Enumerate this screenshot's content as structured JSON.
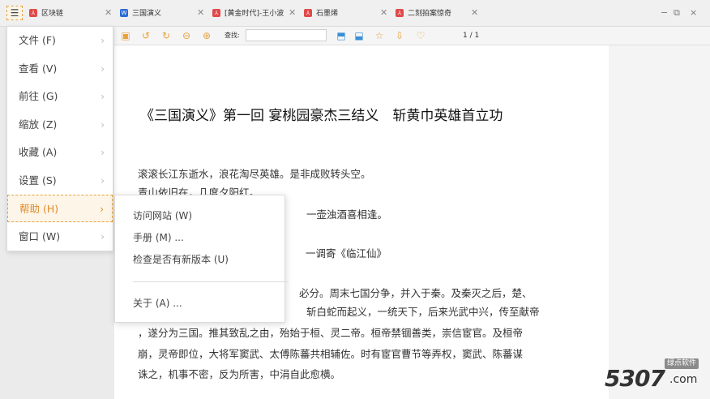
{
  "tabs": [
    {
      "label": "区块链",
      "icon": "pdf-icon",
      "color": "#e04a4a"
    },
    {
      "label": "三国演义",
      "icon": "word-icon",
      "color": "#2b6bd6"
    },
    {
      "label": "[黄金时代]-王小波",
      "icon": "pdf-icon",
      "color": "#e04a4a"
    },
    {
      "label": "石墨烯",
      "icon": "pdf-icon",
      "color": "#e04a4a"
    },
    {
      "label": "二刻拍案惊奇",
      "icon": "pdf-icon",
      "color": "#e04a4a"
    }
  ],
  "window_controls": {
    "minimize": "−",
    "restore": "⧉",
    "close": "×"
  },
  "toolbar": {
    "search_label": "查找:",
    "search_value": "",
    "page_count": "1 / 1",
    "icons": [
      "open-icon",
      "undo-icon",
      "redo-icon",
      "zoom-out-icon",
      "zoom-in-icon",
      "prev-page-icon",
      "next-page-icon",
      "favorite-star-icon",
      "download-icon",
      "vip-heart-icon"
    ]
  },
  "main_menu": {
    "items": [
      {
        "label": "文件 (F)"
      },
      {
        "label": "查看 (V)"
      },
      {
        "label": "前往 (G)"
      },
      {
        "label": "缩放 (Z)"
      },
      {
        "label": "收藏 (A)"
      },
      {
        "label": "设置 (S)"
      },
      {
        "label": "帮助 (H)"
      },
      {
        "label": "窗口 (W)"
      }
    ],
    "active_color": "#e0892a"
  },
  "help_submenu": {
    "items": [
      "访问网站 (W)",
      "手册 (M) ...",
      "检查是否有新版本 (U)",
      "关于 (A) ..."
    ]
  },
  "document": {
    "title": "《三国演义》第一回 宴桃园豪杰三结义　斩黄巾英雄首立功",
    "lines": [
      "滚滚长江东逝水，浪花淘尽英雄。是非成败转头空。",
      "青山依旧在，几度夕阳红。",
      "一壶浊酒喜相逢。",
      "一调寄《临江仙》",
      "必分。周末七国分争，并入于秦。及秦灭之后，楚、",
      "斩白蛇而起义，一统天下，后来光武中兴，传至献帝",
      "，遂分为三国。推其致乱之由，殆始于桓、灵二帝。桓帝禁锢善类，崇信宦官。及桓帝",
      "崩，灵帝即位，大将军窦武、太傅陈蕃共相辅佐。时有宦官曹节等弄权，窦武、陈蕃谋",
      "诛之，机事不密，反为所害，中涓自此愈横。"
    ]
  },
  "watermark": {
    "badge": "绿点软件",
    "text": "5307",
    "suffix": ".com"
  }
}
